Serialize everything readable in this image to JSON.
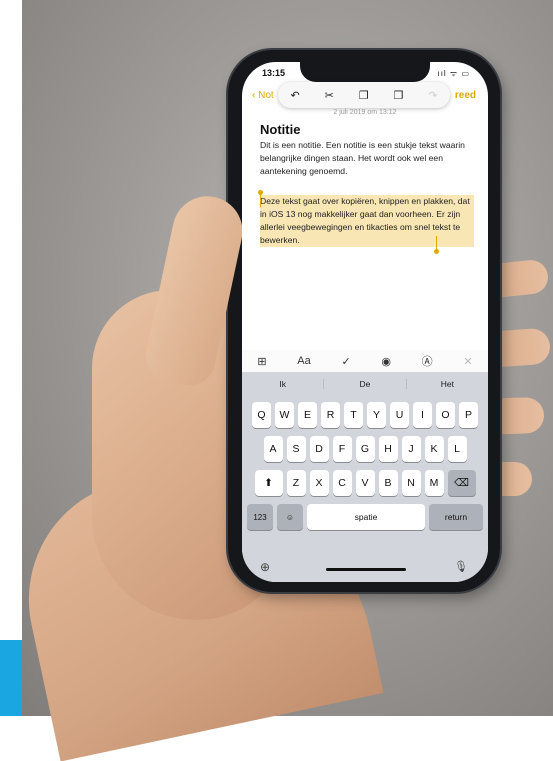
{
  "status": {
    "time": "13:15",
    "icons": "ııl ᯤ ▭"
  },
  "nav": {
    "back_label": "Not",
    "done_label": "reed"
  },
  "edit_toolbar": [
    "↶",
    "✂",
    "❐",
    "❐",
    "↷"
  ],
  "note": {
    "date": "2 juli 2019 om 13:12",
    "title": "Notitie",
    "paragraph1": "Dit is een notitie. Een notitie is een stukje tekst waarin belangrijke dingen staan. Het wordt ook wel een aantekening genoemd.",
    "paragraph2": "Deze tekst gaat over kopiëren, knippen en plakken, dat in iOS 13 nog makkelijker gaat dan voorheen. Er zijn allerlei veegbewegingen en tikacties om snel tekst te bewerken."
  },
  "format_bar": [
    "⊞",
    "Aa",
    "✓",
    "◉",
    "Ⓐ",
    "✕"
  ],
  "keyboard": {
    "suggestions": [
      "Ik",
      "De",
      "Het"
    ],
    "row1": [
      "Q",
      "W",
      "E",
      "R",
      "T",
      "Y",
      "U",
      "I",
      "O",
      "P"
    ],
    "row2": [
      "A",
      "S",
      "D",
      "F",
      "G",
      "H",
      "J",
      "K",
      "L"
    ],
    "row3": [
      "Z",
      "X",
      "C",
      "V",
      "B",
      "N",
      "M"
    ],
    "shift": "⬆",
    "backspace": "⌫",
    "numbers": "123",
    "emoji": "☺",
    "space": "spatie",
    "return": "return",
    "globe": "⊕",
    "mic": "🎙"
  },
  "colors": {
    "accent": "#e0a800",
    "selection": "#f8e7b4",
    "brand_tab": "#1aa6e0"
  }
}
